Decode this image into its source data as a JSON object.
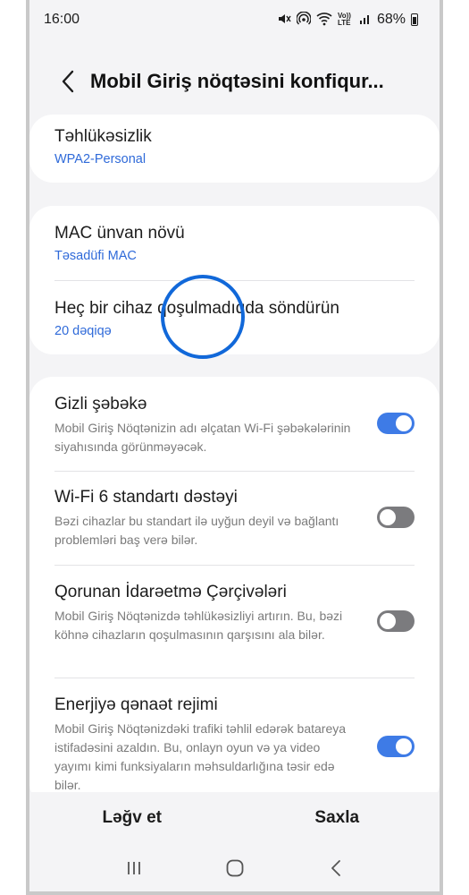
{
  "status_bar": {
    "time": "16:00",
    "network_label": "Vo)) LTE",
    "battery_text": "68%"
  },
  "header": {
    "title": "Mobil Giriş nöqtəsini konfiqur..."
  },
  "security": {
    "title": "Təhlükəsizlik",
    "value": "WPA2-Personal"
  },
  "mac": {
    "title": "MAC ünvan növü",
    "value": "Təsadüfi MAC"
  },
  "auto_off": {
    "title": "Heç bir cihaz qoşulmadıqda söndürün",
    "value": "20 dəqiqə"
  },
  "toggles": [
    {
      "title": "Gizli şəbəkə",
      "description": "Mobil Giriş Nöqtənizin adı əlçatan Wi-Fi şəbəkələrinin siyahısında görünməyəcək.",
      "on": true
    },
    {
      "title": "Wi-Fi 6 standartı dəstəyi",
      "description": "Bəzi cihazlar bu standart ilə uyğun deyil və bağlantı problemləri baş verə bilər.",
      "on": false
    },
    {
      "title": "Qorunan İdarəetmə Çərçivələri",
      "description": "Mobil Giriş Nöqtənizdə təhlükəsizliyi artırın. Bu, bəzi köhnə cihazların qoşulmasının qarşısını ala bilər.",
      "on": false
    },
    {
      "title": "Enerjiyə qənaət rejimi",
      "description": "Mobil Giriş Nöqtənizdəki trafiki təhlil edərək batareya istifadəsini azaldın. Bu, onlayn oyun və ya video yayımı kimi funksiyaların məhsuldarlığına təsir edə bilər.",
      "on": true
    }
  ],
  "actions": {
    "cancel_label": "Ləğv et",
    "save_label": "Saxla"
  },
  "colors": {
    "accent": "#3e7be6",
    "link": "#2f6ad9",
    "highlight": "#1168d9",
    "toggle_off": "#7b7b7e"
  },
  "icons": [
    "mute-icon",
    "hotspot-icon",
    "wifi-icon",
    "signal-icon",
    "battery-icon",
    "back-icon",
    "recents-icon",
    "home-icon",
    "back-nav-icon"
  ]
}
